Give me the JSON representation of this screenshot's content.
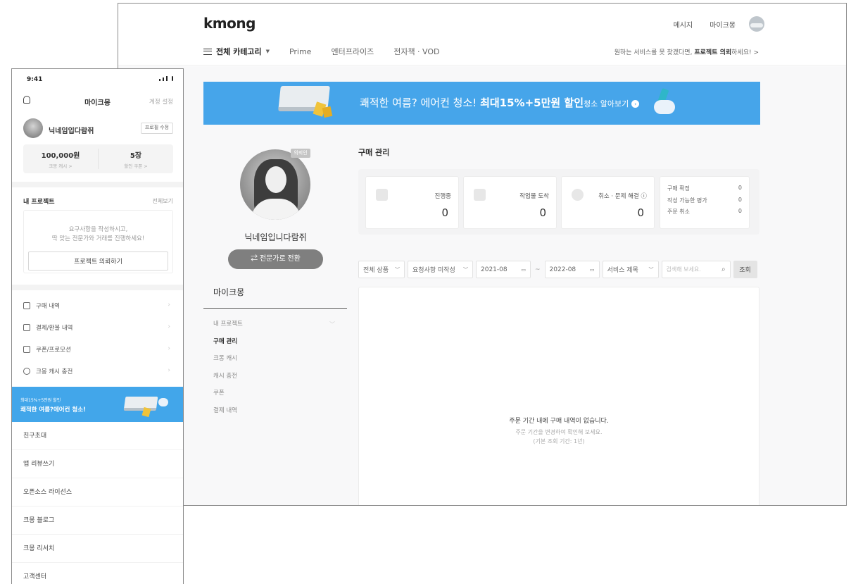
{
  "desktop": {
    "logo": "kmong",
    "top_links": [
      "메시지",
      "마이크몽"
    ],
    "catnav": {
      "all_label": "전체 카테고리",
      "items": [
        "Prime",
        "엔터프라이즈",
        "전자책 · VOD"
      ]
    },
    "top_cta_prefix": "원하는 서비스를 못 찾겠다면, ",
    "top_cta_bold": "프로젝트 의뢰",
    "top_cta_suffix": "하세요! >",
    "banner": {
      "text_plain": "쾌적한 여름? 에어컨 청소! ",
      "text_bold": "최대15%+5만원 할인",
      "learn_more": "청소 알아보기",
      "accent_color": "#46a5ea"
    },
    "profile": {
      "badge": "의뢰인",
      "name": "닉네임입니다람쥐",
      "switch_button": "⇄ 전문가로 전환"
    },
    "sidebar": {
      "title": "마이크몽",
      "items": [
        "내 프로젝트",
        "구매 관리",
        "크몽 캐시",
        "캐시 충전",
        "쿠폰",
        "결제 내역"
      ],
      "active_index": 1
    },
    "purchase": {
      "title": "구매 관리",
      "stats": [
        {
          "label": "진행중",
          "value": "0",
          "icon": "grid-icon"
        },
        {
          "label": "작업물 도착",
          "value": "0",
          "icon": "folder-icon"
        },
        {
          "label": "취소 · 문제 해결 ⓘ",
          "value": "0",
          "icon": "alert-icon"
        }
      ],
      "stat_list": [
        {
          "label": "구매 확정",
          "value": "0"
        },
        {
          "label": "작성 가능한 평가",
          "value": "0"
        },
        {
          "label": "주문 취소",
          "value": "0"
        }
      ],
      "filters": {
        "product": "전체 상품",
        "request": "요청사항 미작성",
        "date_from": "2021-08",
        "date_sep": "~",
        "date_to": "2022-08",
        "service": "서비스 제목",
        "search_placeholder": "검색해 보세요.",
        "search_button": "조회"
      },
      "empty": {
        "line1": "주문 기간 내에 구매 내역이 없습니다.",
        "line2": "주문 기간을 변경하여 확인해 보세요.",
        "line3": "(기본 조회 기간: 1년)"
      }
    }
  },
  "mobile": {
    "time": "9:41",
    "title": "마이크몽",
    "settings": "계정 설정",
    "name": "닉네임입다람쥐",
    "edit_button": "프로필 수정",
    "cash": {
      "value": "100,000원",
      "label": "크몽 캐시 >"
    },
    "coupon": {
      "value": "5장",
      "label": "할인 쿠폰 >"
    },
    "project": {
      "title": "내 프로젝트",
      "view_all": "전체보기",
      "desc1": "요구사항을 작성하시고,",
      "desc2": "딱 맞는 전문가와 거래를 진행하세요!",
      "button": "프로젝트 의뢰하기"
    },
    "menu": [
      {
        "label": "구매 내역",
        "icon": "bag-icon"
      },
      {
        "label": "결제/환불 내역",
        "icon": "card-icon"
      },
      {
        "label": "쿠폰/프로모션",
        "icon": "coupon-icon"
      },
      {
        "label": "크몽 캐시 충전",
        "icon": "cash-icon"
      }
    ],
    "promo": {
      "small": "최대15%+5만원 할인",
      "big": "쾌적한 여름?에어컨 청소!"
    },
    "links": [
      "친구초대",
      "앱 리뷰쓰기",
      "오픈소스 라이선스",
      "크몽 블로그",
      "크몽 리서치",
      "고객센터"
    ]
  }
}
